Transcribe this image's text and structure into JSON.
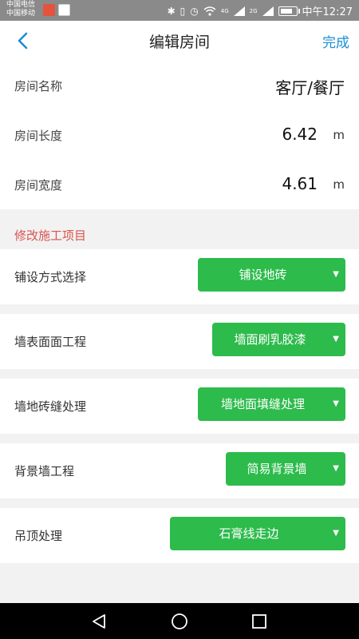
{
  "status_bar": {
    "carrier_1": "中国电信",
    "carrier_2": "中国移动",
    "time": "中午12:27",
    "network_1": "4G",
    "network_2": "2G",
    "icons": [
      "app-notification-icon-1",
      "app-notification-icon-2",
      "bluetooth-icon",
      "vibrate-icon",
      "alarm-icon",
      "wifi-icon",
      "signal-icon",
      "battery-icon"
    ]
  },
  "nav": {
    "title": "编辑房间",
    "done_label": "完成",
    "accent_color": "#1a8fd6"
  },
  "room": {
    "name_label": "房间名称",
    "name_value": "客厅/餐厅",
    "length_label": "房间长度",
    "length_value": "6.42",
    "length_unit": "m",
    "width_label": "房间宽度",
    "width_value": "4.61",
    "width_unit": "m"
  },
  "section": {
    "title": "修改施工项目",
    "title_color": "#d9534f"
  },
  "options": [
    {
      "label": "铺设方式选择",
      "selected": "铺设地砖"
    },
    {
      "label": "墙表面面工程",
      "selected": "墙面刷乳胶漆"
    },
    {
      "label": "墙地砖缝处理",
      "selected": "墙地面填缝处理"
    },
    {
      "label": "背景墙工程",
      "selected": "简易背景墙"
    },
    {
      "label": "吊顶处理",
      "selected": "石膏线走边"
    }
  ],
  "select_color": "#2dbb4c",
  "system_nav": {
    "icons": [
      "back-triangle-icon",
      "home-circle-icon",
      "recents-square-icon"
    ]
  }
}
